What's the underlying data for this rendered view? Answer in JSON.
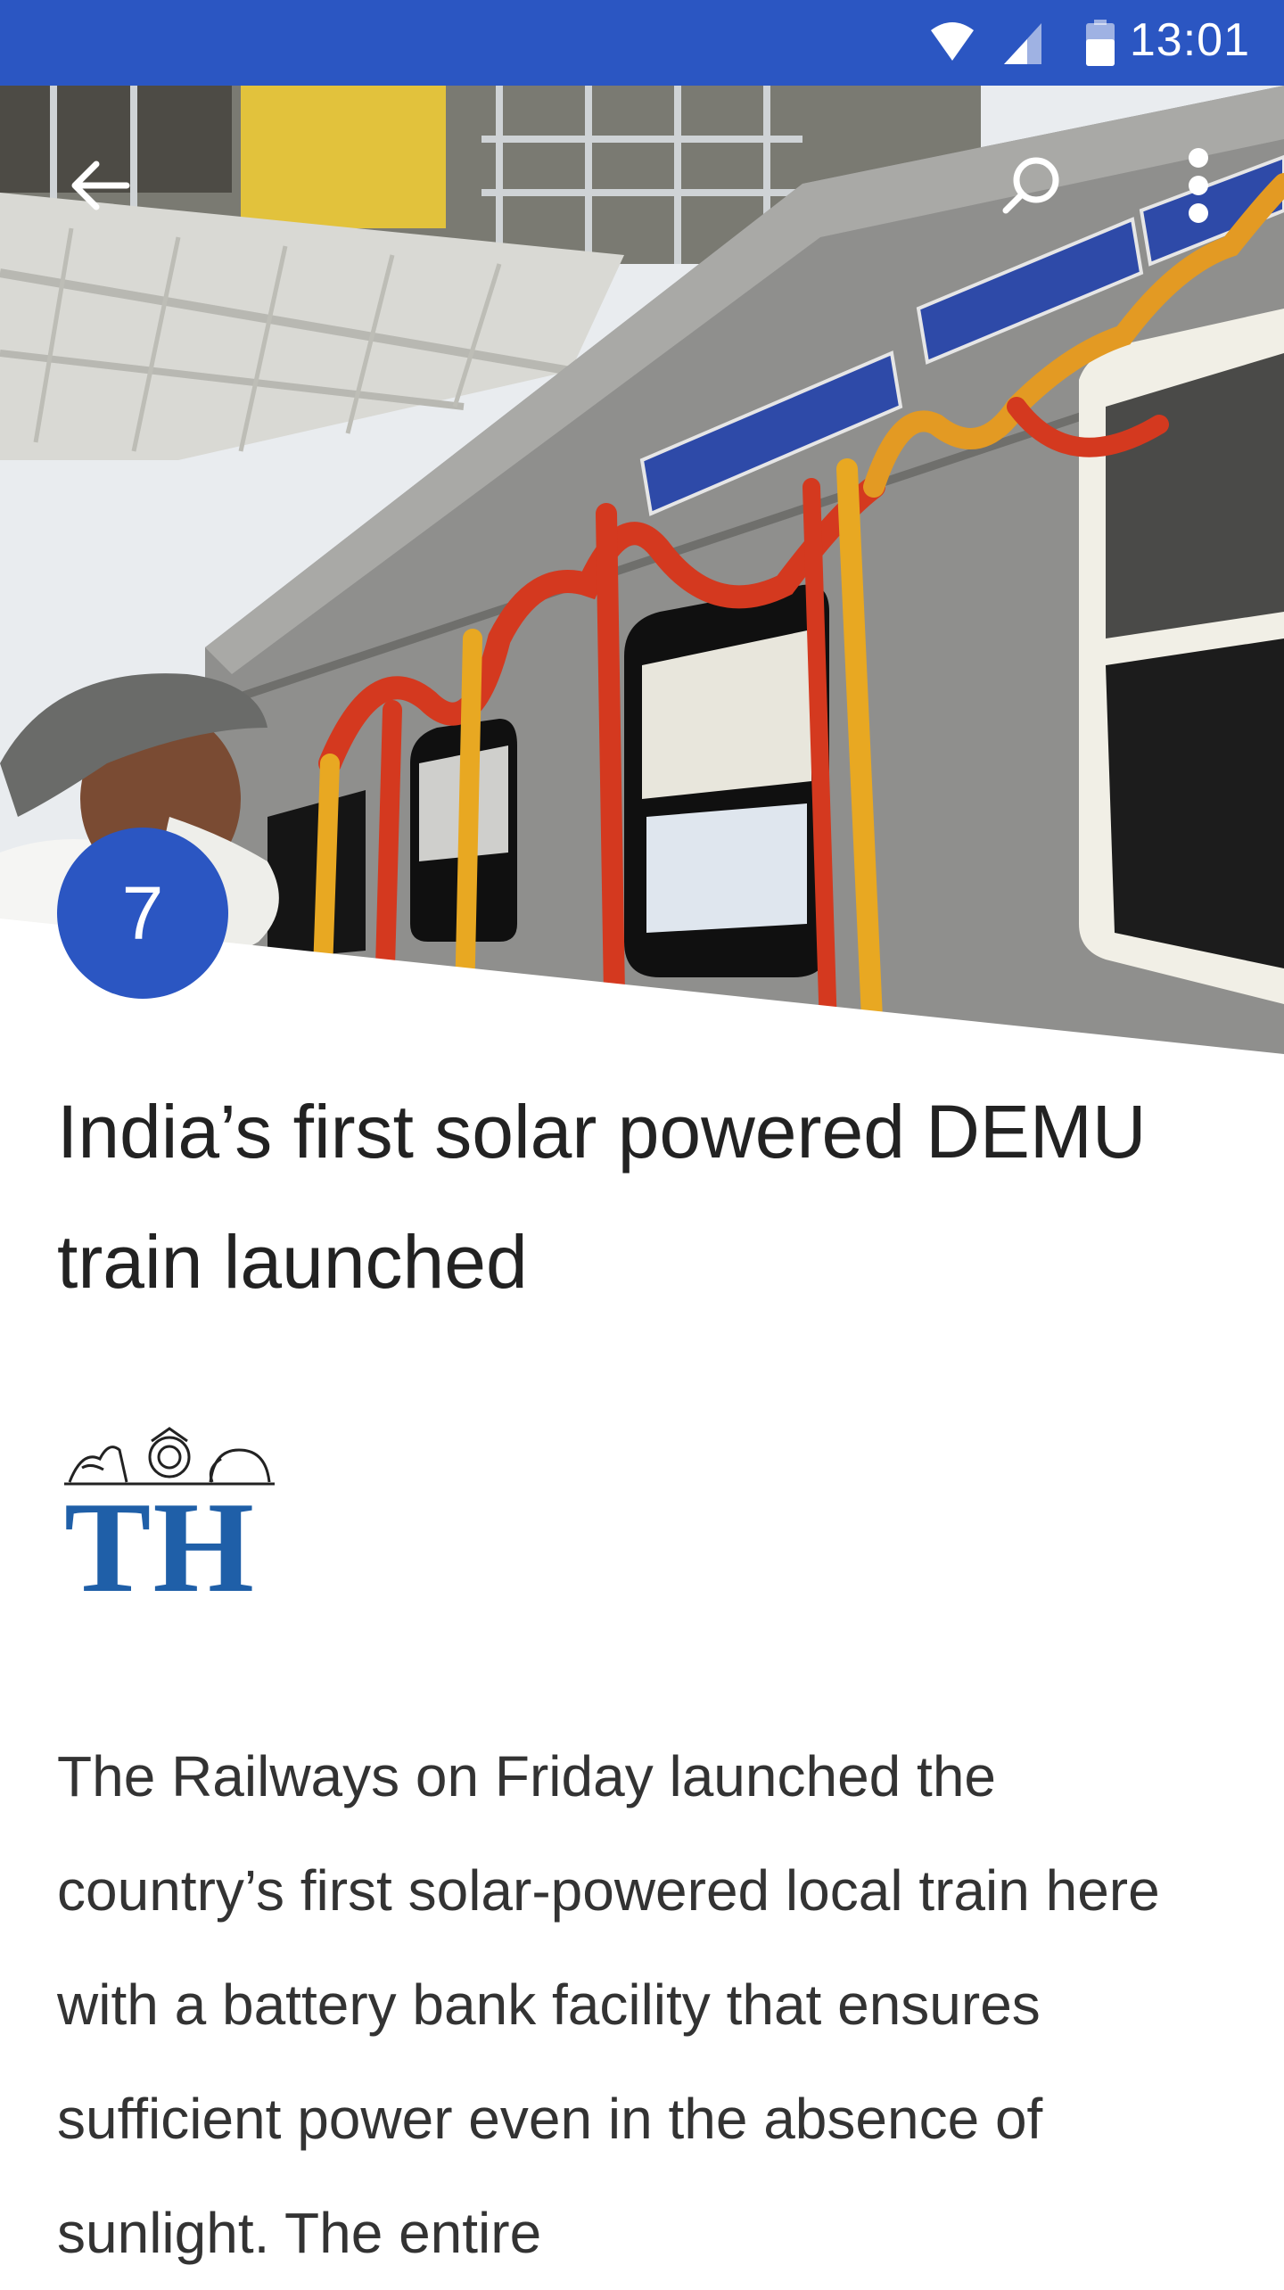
{
  "status_bar": {
    "time": "13:01",
    "icons": [
      "wifi-icon",
      "cell-signal-icon",
      "battery-icon"
    ],
    "background": "#2b56c2"
  },
  "toolbar": {
    "icons": [
      "back-arrow-icon",
      "search-icon",
      "more-vert-icon"
    ]
  },
  "article": {
    "rank_badge": "7",
    "headline": "India’s first solar powered DEMU train launched",
    "source": {
      "logo_text": "TH",
      "logo_color": "#1f5fa8"
    },
    "body": "The Railways on Friday launched the country’s first solar-powered local train here with a battery bank facility that ensures sufficient power even in the absence of sunlight. The entire"
  },
  "colors": {
    "accent": "#2b56c2",
    "headline": "#222222",
    "body": "#333333"
  }
}
